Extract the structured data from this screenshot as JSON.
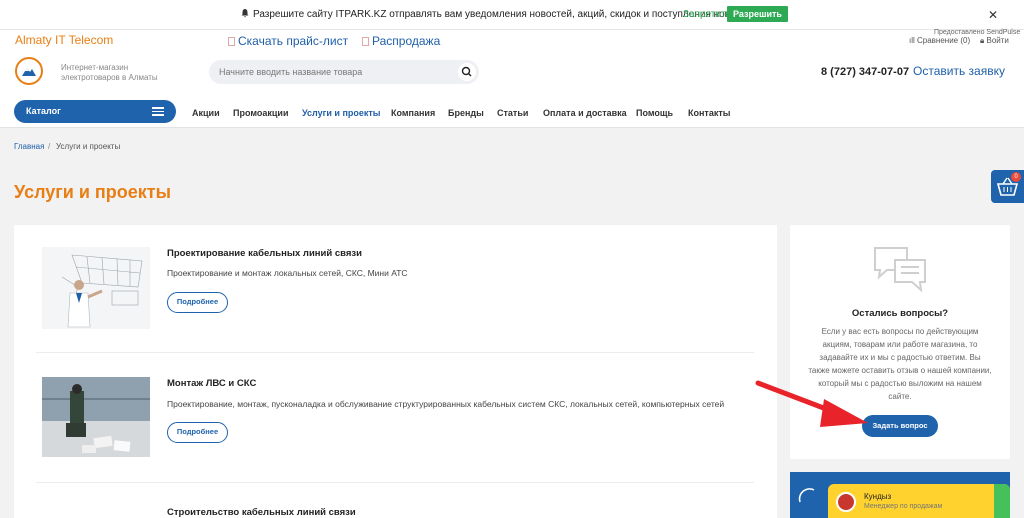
{
  "notification": {
    "text": "Разрешите сайту ITPARK.KZ отправлять вам уведомления новостей, акций, скидок и поступления новинок!",
    "deny_label": "Запретить",
    "allow_label": "Разрешить",
    "close_label": "✕",
    "sendpulse": "Предоставлено SendPulse"
  },
  "topbar": {
    "brand": "Almaty IT Telecom",
    "pricelist": "Скачать прайс-лист",
    "sale": "Распродажа",
    "compare": "Сравнение (0)",
    "login": "Войти"
  },
  "header": {
    "tagline": "Интернет-магазин электротоваров в Алматы",
    "search_placeholder": "Начните вводить название товара",
    "phone": "8 (727) 347-07-07",
    "order_call": "Оставить заявку"
  },
  "nav": {
    "catalog": "Каталог",
    "items": [
      "Акции",
      "Промоакции",
      "Услуги и проекты",
      "Компания",
      "Бренды",
      "Статьи",
      "Оплата и доставка",
      "Помощь",
      "Контакты"
    ],
    "active_index": 2
  },
  "breadcrumb": {
    "home": "Главная",
    "separator": "/",
    "current": "Услуги и проекты"
  },
  "page_title": "Услуги и проекты",
  "basket_count": "0",
  "services": [
    {
      "title": "Проектирование кабельных линий связи",
      "description": "Проектирование и монтаж локальных сетей, СКС, Мини АТС",
      "button": "Подробнее"
    },
    {
      "title": "Монтаж ЛВС и СКС",
      "description": "Проектирование, монтаж, пусконаладка и обслуживание структурированных кабельных систем СКС, локальных сетей, компьютерных сетей",
      "button": "Подробнее"
    },
    {
      "title": "Строительство кабельных линий связи"
    }
  ],
  "questions": {
    "title": "Остались вопросы?",
    "text": "Если у вас есть вопросы по действующим акциям, товарам или работе магазина, то задавайте их и мы с радостью ответим. Вы также можете оставить отзыв о нашей компании, который мы с радостью выложим на нашем сайте.",
    "button": "Задать вопрос"
  },
  "chat": {
    "name": "Кундыз",
    "role": "Менеджер по продажам"
  },
  "colors": {
    "accent": "#e87e14",
    "primary": "#1f63ac",
    "allow": "#2eaa55",
    "arrow": "#e8242a"
  }
}
